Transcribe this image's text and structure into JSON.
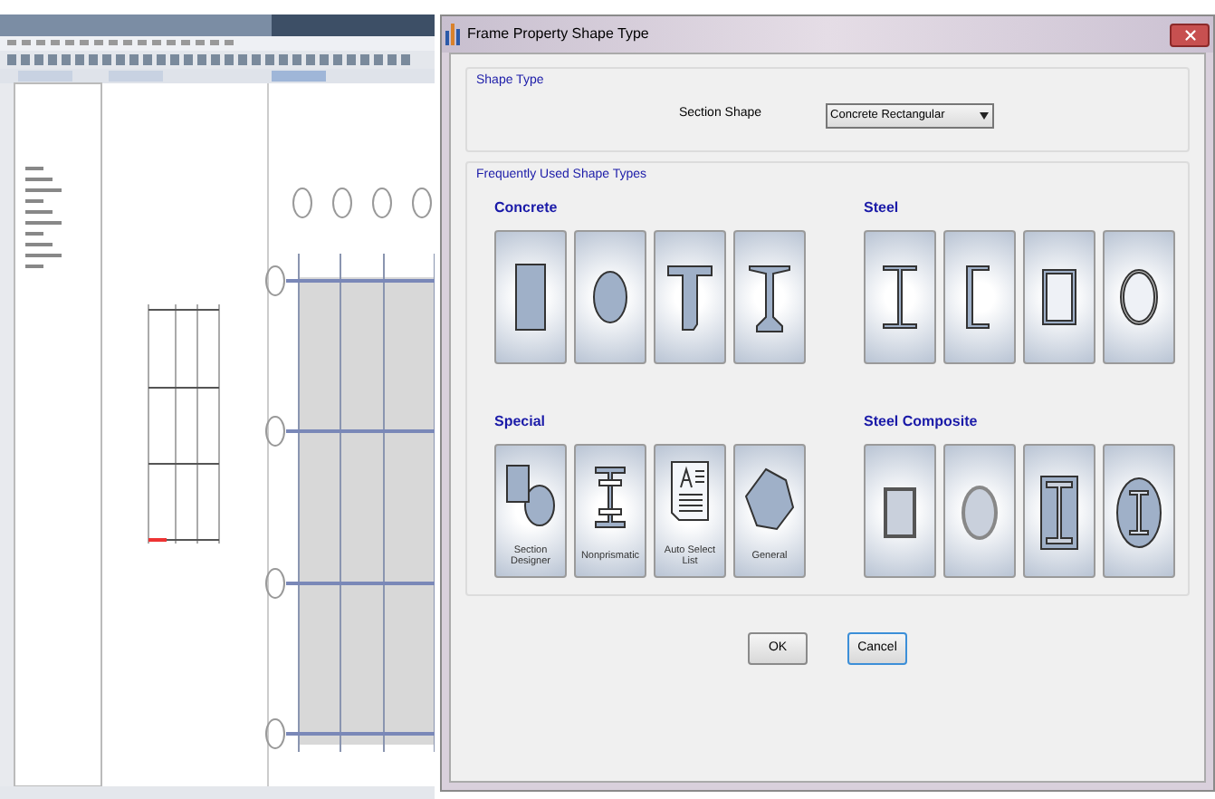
{
  "dialog": {
    "title": "Frame Property Shape Type",
    "shape_type": {
      "legend": "Shape Type",
      "label": "Section Shape",
      "value": "Concrete Rectangular"
    },
    "frequently_used": {
      "legend": "Frequently Used Shape Types",
      "groups": [
        {
          "title": "Concrete",
          "shapes": [
            {
              "kind": "rect"
            },
            {
              "kind": "ellipse"
            },
            {
              "kind": "tee"
            },
            {
              "kind": "ibeam"
            }
          ]
        },
        {
          "title": "Steel",
          "shapes": [
            {
              "kind": "steel_i"
            },
            {
              "kind": "channel"
            },
            {
              "kind": "box"
            },
            {
              "kind": "pipe"
            }
          ]
        },
        {
          "title": "Special",
          "shapes": [
            {
              "kind": "designer",
              "label": "Section Designer"
            },
            {
              "kind": "nonprismatic",
              "label": "Nonprismatic"
            },
            {
              "kind": "list",
              "label": "Auto Select List"
            },
            {
              "kind": "general",
              "label": "General"
            }
          ]
        },
        {
          "title": "Steel Composite",
          "shapes": [
            {
              "kind": "comp_box"
            },
            {
              "kind": "comp_pipe"
            },
            {
              "kind": "comp_i"
            },
            {
              "kind": "comp_round"
            }
          ]
        }
      ]
    },
    "buttons": [
      {
        "label": "OK",
        "focused": false
      },
      {
        "label": "Cancel",
        "focused": true
      }
    ]
  }
}
